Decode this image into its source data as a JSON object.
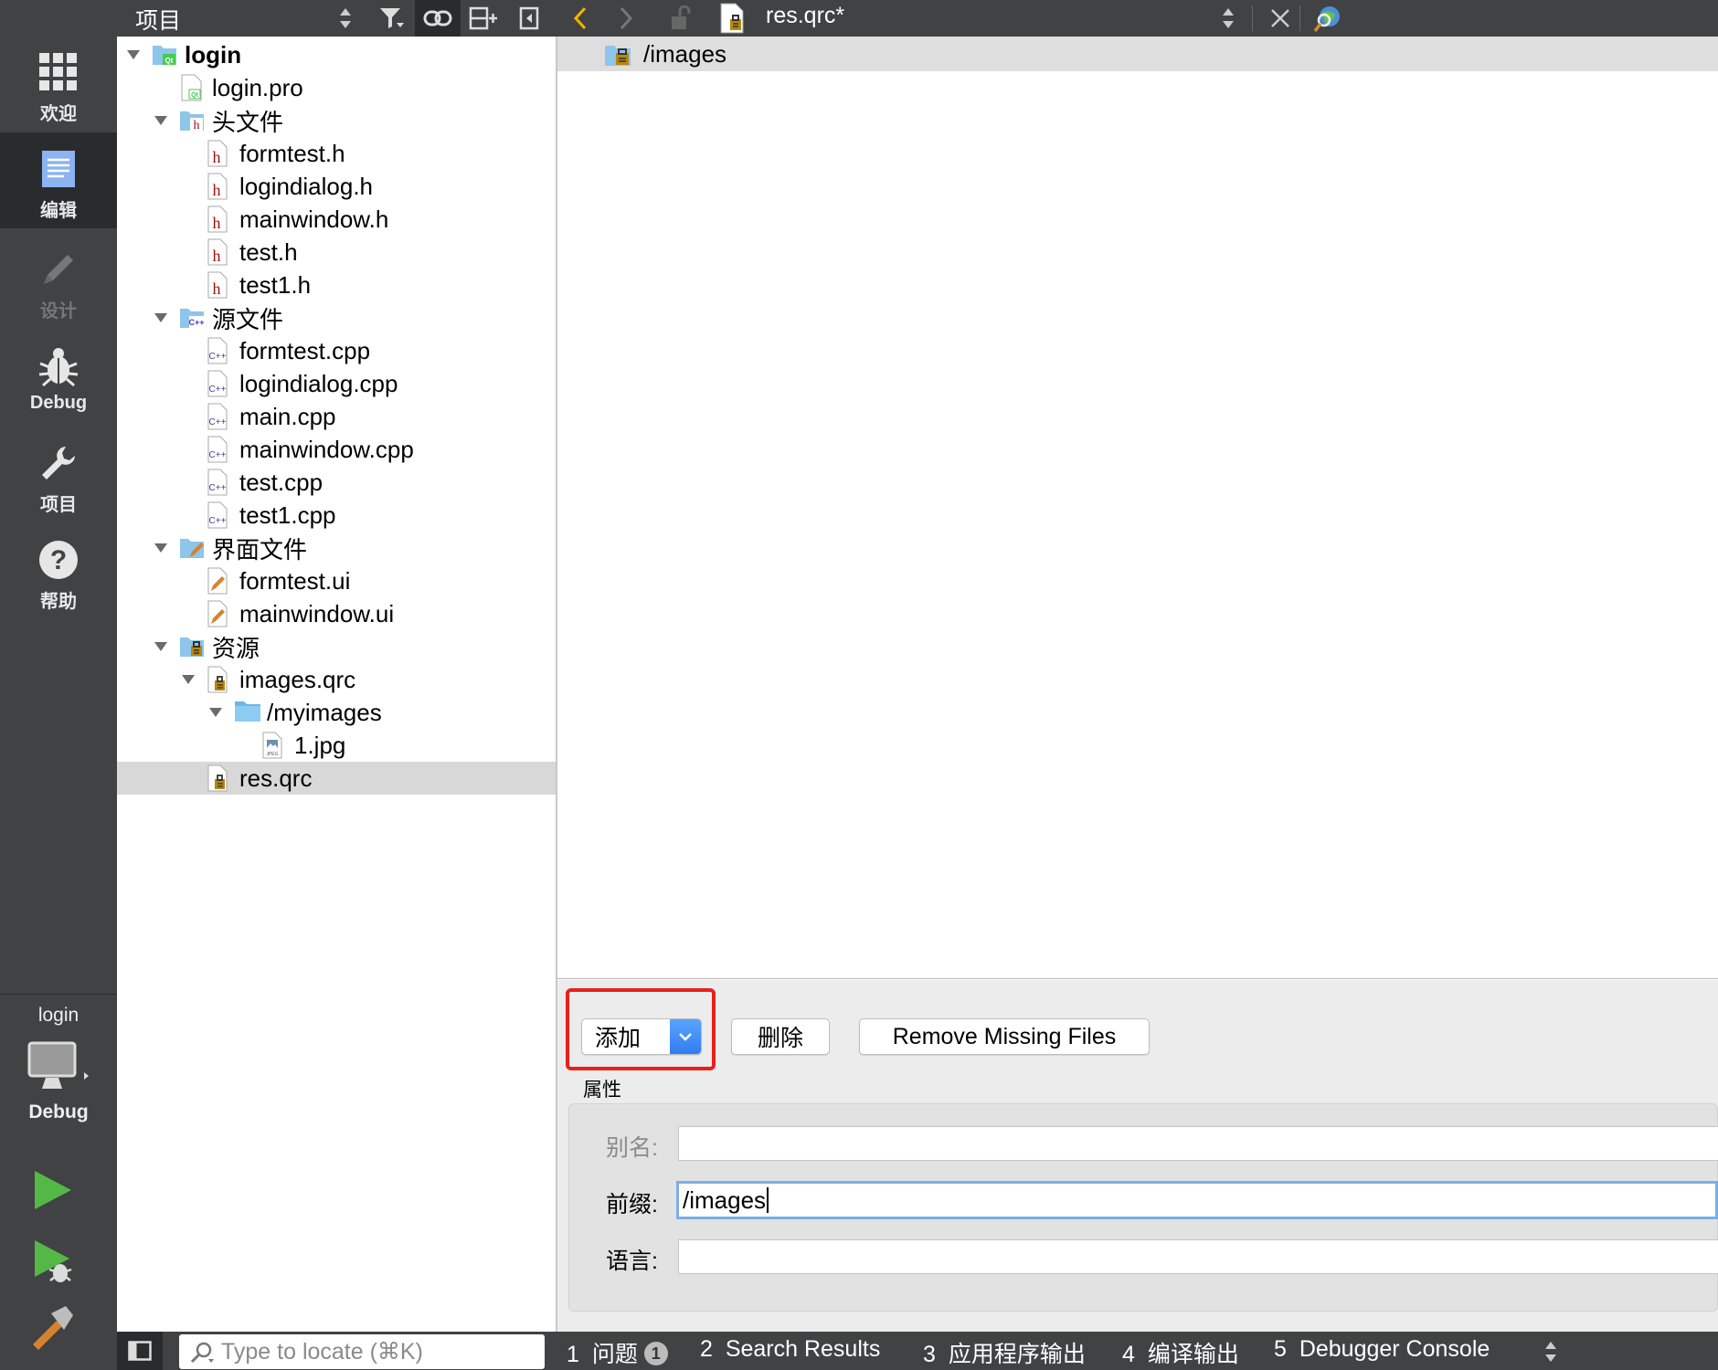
{
  "modes": [
    {
      "id": "welcome",
      "label": "欢迎",
      "icon": "grid-icon",
      "active": false,
      "enabled": true
    },
    {
      "id": "edit",
      "label": "编辑",
      "icon": "edit-document-icon",
      "active": true,
      "enabled": true
    },
    {
      "id": "design",
      "label": "设计",
      "icon": "pencil-icon",
      "active": false,
      "enabled": false
    },
    {
      "id": "debug",
      "label": "Debug",
      "icon": "bug-icon",
      "active": false,
      "enabled": true
    },
    {
      "id": "projects",
      "label": "项目",
      "icon": "wrench-icon",
      "active": false,
      "enabled": true
    },
    {
      "id": "help",
      "label": "帮助",
      "icon": "help-icon",
      "active": false,
      "enabled": true
    }
  ],
  "kit": {
    "project": "login",
    "build": "Debug"
  },
  "project_panel": {
    "title": "项目"
  },
  "tree": [
    {
      "label": "login",
      "indent": 0,
      "arrow": "expanded",
      "icon": "project",
      "bold": true
    },
    {
      "label": "login.pro",
      "indent": 1,
      "arrow": "none",
      "icon": "pro"
    },
    {
      "label": "头文件",
      "indent": 1,
      "arrow": "expanded",
      "icon": "folder-h"
    },
    {
      "label": "formtest.h",
      "indent": 2,
      "arrow": "none",
      "icon": "h"
    },
    {
      "label": "logindialog.h",
      "indent": 2,
      "arrow": "none",
      "icon": "h"
    },
    {
      "label": "mainwindow.h",
      "indent": 2,
      "arrow": "none",
      "icon": "h"
    },
    {
      "label": "test.h",
      "indent": 2,
      "arrow": "none",
      "icon": "h"
    },
    {
      "label": "test1.h",
      "indent": 2,
      "arrow": "none",
      "icon": "h"
    },
    {
      "label": "源文件",
      "indent": 1,
      "arrow": "expanded",
      "icon": "folder-cpp"
    },
    {
      "label": "formtest.cpp",
      "indent": 2,
      "arrow": "none",
      "icon": "cpp"
    },
    {
      "label": "logindialog.cpp",
      "indent": 2,
      "arrow": "none",
      "icon": "cpp"
    },
    {
      "label": "main.cpp",
      "indent": 2,
      "arrow": "none",
      "icon": "cpp"
    },
    {
      "label": "mainwindow.cpp",
      "indent": 2,
      "arrow": "none",
      "icon": "cpp"
    },
    {
      "label": "test.cpp",
      "indent": 2,
      "arrow": "none",
      "icon": "cpp"
    },
    {
      "label": "test1.cpp",
      "indent": 2,
      "arrow": "none",
      "icon": "cpp"
    },
    {
      "label": "界面文件",
      "indent": 1,
      "arrow": "expanded",
      "icon": "folder-ui"
    },
    {
      "label": "formtest.ui",
      "indent": 2,
      "arrow": "none",
      "icon": "ui"
    },
    {
      "label": "mainwindow.ui",
      "indent": 2,
      "arrow": "none",
      "icon": "ui"
    },
    {
      "label": "资源",
      "indent": 1,
      "arrow": "expanded",
      "icon": "folder-res"
    },
    {
      "label": "images.qrc",
      "indent": 2,
      "arrow": "expanded",
      "icon": "qrc"
    },
    {
      "label": "/myimages",
      "indent": 3,
      "arrow": "expanded",
      "icon": "folder"
    },
    {
      "label": "1.jpg",
      "indent": 4,
      "arrow": "none",
      "icon": "jpg"
    },
    {
      "label": "res.qrc",
      "indent": 2,
      "arrow": "none",
      "icon": "qrc",
      "selected": true
    }
  ],
  "editor": {
    "filename": "res.qrc*",
    "prefix_row": "/images"
  },
  "buttons": {
    "add": "添加",
    "remove": "删除",
    "remove_missing": "Remove Missing Files"
  },
  "properties": {
    "title": "属性",
    "alias_label": "别名:",
    "alias_value": "",
    "prefix_label": "前缀:",
    "prefix_value": "/images",
    "lang_label": "语言:",
    "lang_value": ""
  },
  "statusbar": {
    "locator_placeholder": "Type to locate (⌘K)",
    "tabs": [
      {
        "num": "1",
        "label": "问题",
        "badge": "1"
      },
      {
        "num": "2",
        "label": "Search Results"
      },
      {
        "num": "3",
        "label": "应用程序输出"
      },
      {
        "num": "4",
        "label": "编译输出"
      },
      {
        "num": "5",
        "label": "Debugger Console"
      }
    ]
  }
}
